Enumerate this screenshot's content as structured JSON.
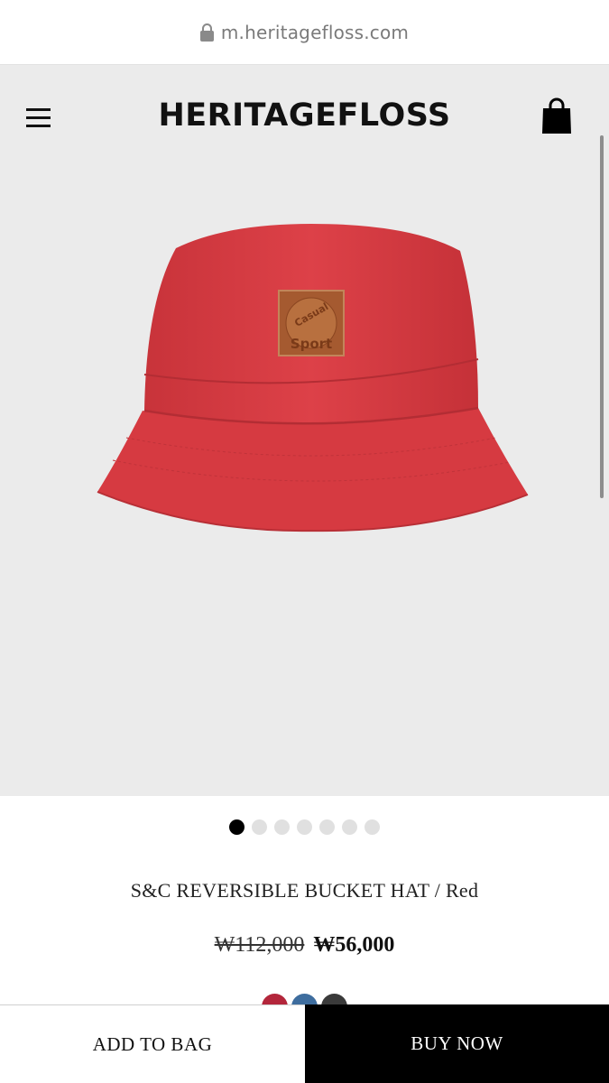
{
  "browser": {
    "url": "m.heritagefloss.com"
  },
  "header": {
    "brand": "HERITAGEFLOSS",
    "menu_icon": "hamburger-menu-icon",
    "bag_icon": "shopping-bag-icon"
  },
  "product": {
    "image_alt": "red bucket hat with leather patch",
    "patch_text_top": "Casual",
    "patch_text_bottom": "Sport",
    "name": "S&C REVERSIBLE BUCKET HAT / Red",
    "original_price": "₩112,000",
    "sale_price": "₩56,000"
  },
  "carousel": {
    "total": 7,
    "active_index": 0
  },
  "colors": {
    "hat_red": "#d83a40",
    "background": "#ebebeb",
    "swatch_red": "#b3263b",
    "swatch_blue": "#3e6d9e",
    "swatch_charcoal": "#3a3a3a"
  },
  "actions": {
    "add_to_bag": "ADD TO BAG",
    "buy_now": "BUY NOW"
  }
}
